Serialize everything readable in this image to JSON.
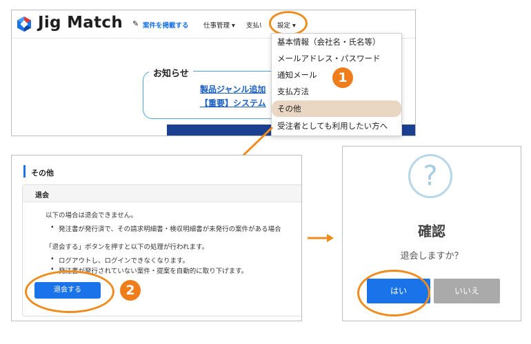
{
  "header": {
    "brand": "Jig Match",
    "post_job_link": "案件を掲載する",
    "nav": {
      "jobs": "仕事管理 ▾",
      "payment": "支払い",
      "settings": "設定 ▾"
    }
  },
  "news": {
    "title": "お知らせ",
    "links": [
      "製品ジャンル追加",
      "【重要】システム"
    ]
  },
  "settings_menu": {
    "items": [
      "基本情報（会社名・氏名等）",
      "メールアドレス・パスワード",
      "通知メール",
      "支払方法",
      "その他",
      "受注者としても利用したい方へ"
    ],
    "active_index": 4
  },
  "steps": {
    "step1": "1",
    "step2": "2"
  },
  "other_page": {
    "title": "その他",
    "section_title": "退会",
    "cannot_withdraw_intro": "以下の場合は退会できません。",
    "cannot_withdraw_item": "発注書が発行済で、その請求明細書・検収明細書が未発行の案件がある場合",
    "process_intro": "「退会する」ボタンを押すと以下の処理が行われます。",
    "process_items": [
      "ログアウトし、ログインできなくなります。",
      "発注書が発行されていない案件・提案を自動的に取り下げます。"
    ],
    "withdraw_button": "退会する"
  },
  "confirm_dialog": {
    "icon": "?",
    "title": "確認",
    "message": "退会しますか？",
    "yes": "はい",
    "no": "いいえ"
  },
  "colors": {
    "accent": "#1a73e8",
    "highlight": "#f08c1e",
    "badge": "#ee7d1a"
  }
}
